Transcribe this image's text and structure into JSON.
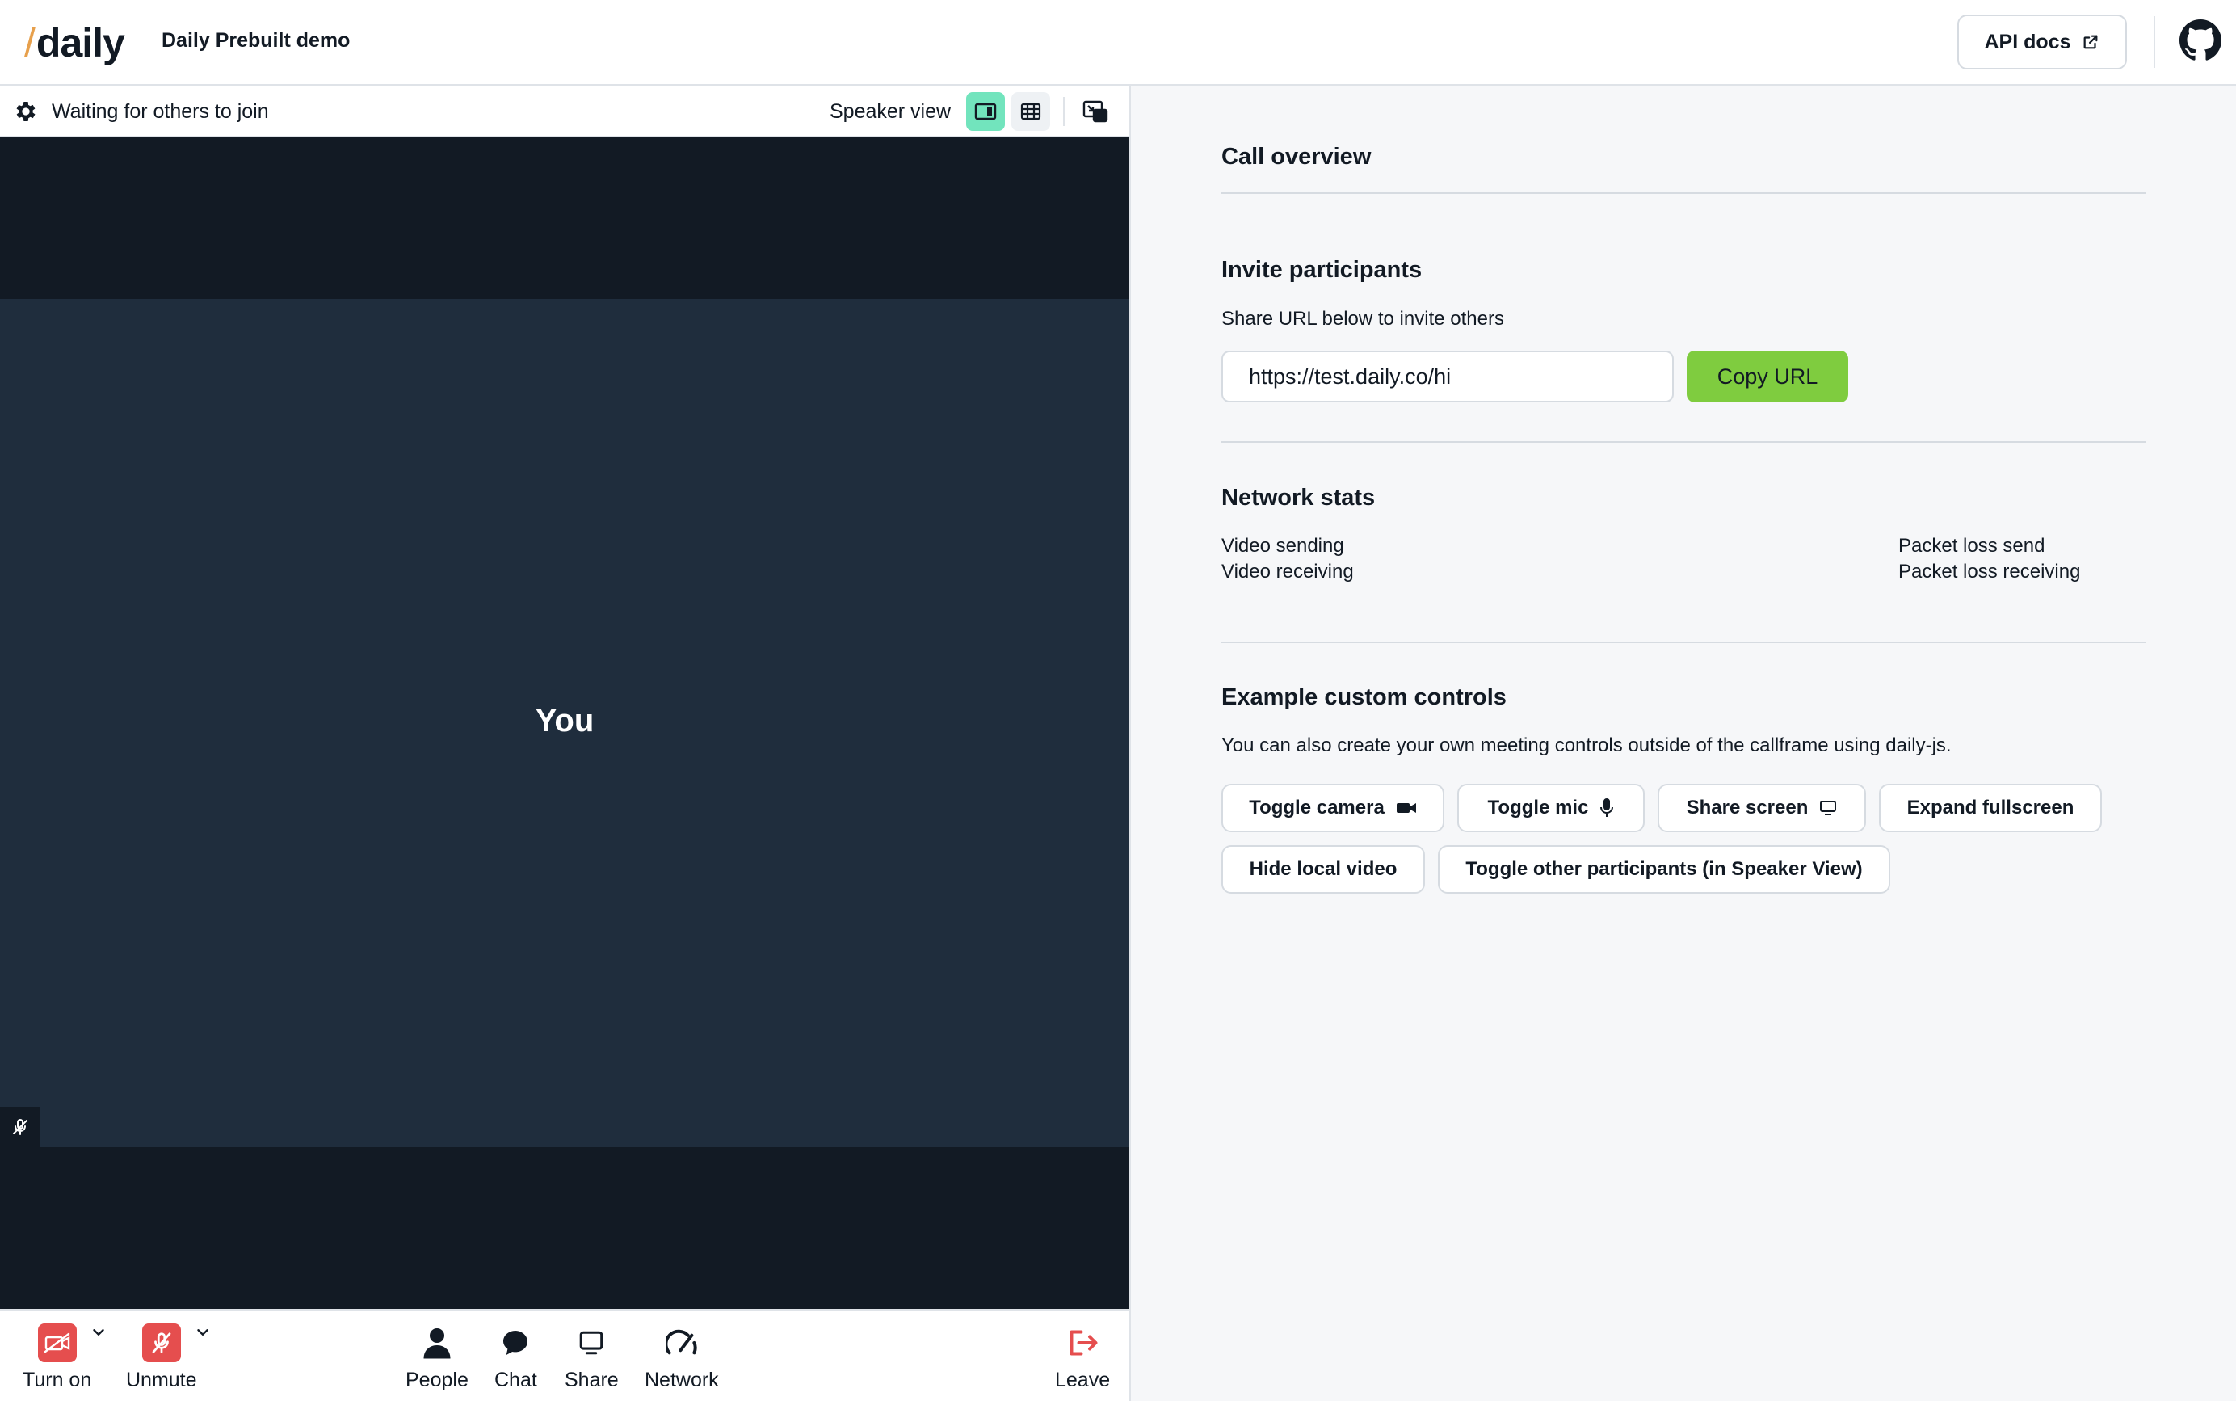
{
  "header": {
    "logo_slash": "/",
    "logo_text": "daily",
    "title": "Daily Prebuilt demo",
    "api_docs_label": "API docs"
  },
  "call": {
    "status_text": "Waiting for others to join",
    "view_label": "Speaker view",
    "local_name": "You",
    "tray": {
      "camera_label": "Turn on",
      "mic_label": "Unmute",
      "people_label": "People",
      "chat_label": "Chat",
      "share_label": "Share",
      "network_label": "Network",
      "leave_label": "Leave"
    }
  },
  "panel": {
    "overview_title": "Call overview",
    "invite": {
      "title": "Invite participants",
      "description": "Share URL below to invite others",
      "url": "https://test.daily.co/hi",
      "copy_label": "Copy URL"
    },
    "network": {
      "title": "Network stats",
      "video_sending": "Video sending",
      "video_receiving": "Video receiving",
      "packet_loss_send": "Packet loss send",
      "packet_loss_receiving": "Packet loss receiving"
    },
    "controls": {
      "title": "Example custom controls",
      "description": "You can also create your own meeting controls outside of the callframe using daily-js.",
      "toggle_camera": "Toggle camera",
      "toggle_mic": "Toggle mic",
      "share_screen": "Share screen",
      "expand_fullscreen": "Expand fullscreen",
      "hide_local_video": "Hide local video",
      "toggle_others": "Toggle other participants (in Speaker View)"
    }
  },
  "colors": {
    "accent_green": "#7fcc3f",
    "active_view": "#72e4bd",
    "muted_red": "#e54e4e",
    "video_bg": "#1f2d3d",
    "dark_bg": "#121a24"
  }
}
